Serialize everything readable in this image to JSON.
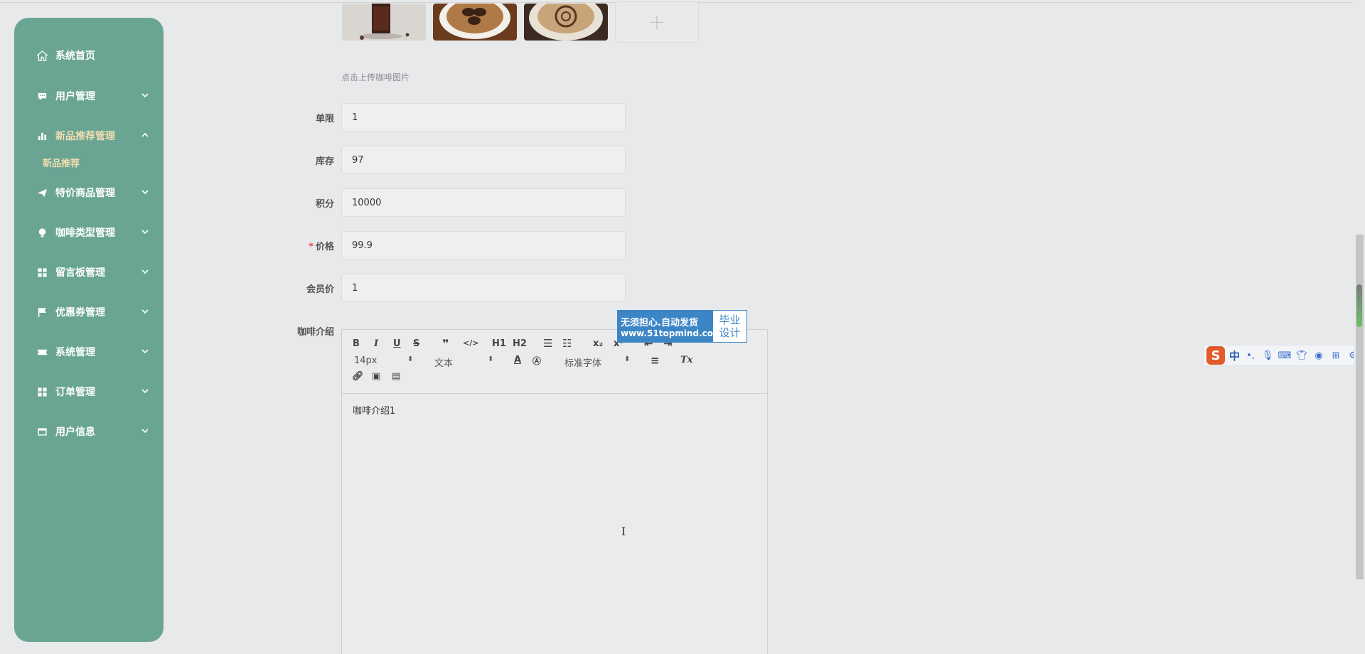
{
  "sidebar": {
    "items": [
      {
        "label": "系统首页",
        "icon": "home-icon"
      },
      {
        "label": "用户管理",
        "icon": "chat-icon"
      },
      {
        "label": "新品推荐管理",
        "icon": "bar-chart-icon"
      },
      {
        "label": "特价商品管理",
        "icon": "send-icon"
      },
      {
        "label": "咖啡类型管理",
        "icon": "bulb-icon"
      },
      {
        "label": "留言板管理",
        "icon": "grid-icon"
      },
      {
        "label": "优惠券管理",
        "icon": "flag-icon"
      },
      {
        "label": "系统管理",
        "icon": "ticket-icon"
      },
      {
        "label": "订单管理",
        "icon": "grid-icon"
      },
      {
        "label": "用户信息",
        "icon": "card-icon"
      }
    ],
    "submenu": {
      "label": "新品推荐"
    },
    "colors": {
      "background": "#6aa594",
      "active_text": "#f3ddb0",
      "text": "#ffffff"
    }
  },
  "form": {
    "upload_hint": "点击上传咖啡图片",
    "fields": {
      "limit": {
        "label": "单限",
        "value": "1"
      },
      "stock": {
        "label": "库存",
        "value": "97"
      },
      "points": {
        "label": "积分",
        "value": "10000"
      },
      "price": {
        "label": "价格",
        "value": "99.9",
        "required": true
      },
      "member_price": {
        "label": "会员价",
        "value": "1"
      },
      "intro": {
        "label": "咖啡介绍"
      }
    }
  },
  "editor": {
    "toolbar": {
      "bold": "B",
      "italic": "I",
      "underline": "U",
      "strike": "S",
      "h1": "H1",
      "h2": "H2",
      "size_select": "14px",
      "text_select": "文本",
      "font_select": "标准字体",
      "clear_format": "Tx"
    },
    "content": "咖啡介绍1"
  },
  "watermark": {
    "line1": "无须担心.自动发货",
    "line2": "www.51topmind.com",
    "right1": "毕业",
    "right2": "设计"
  },
  "ime": {
    "logo": "S",
    "mode": "中"
  }
}
